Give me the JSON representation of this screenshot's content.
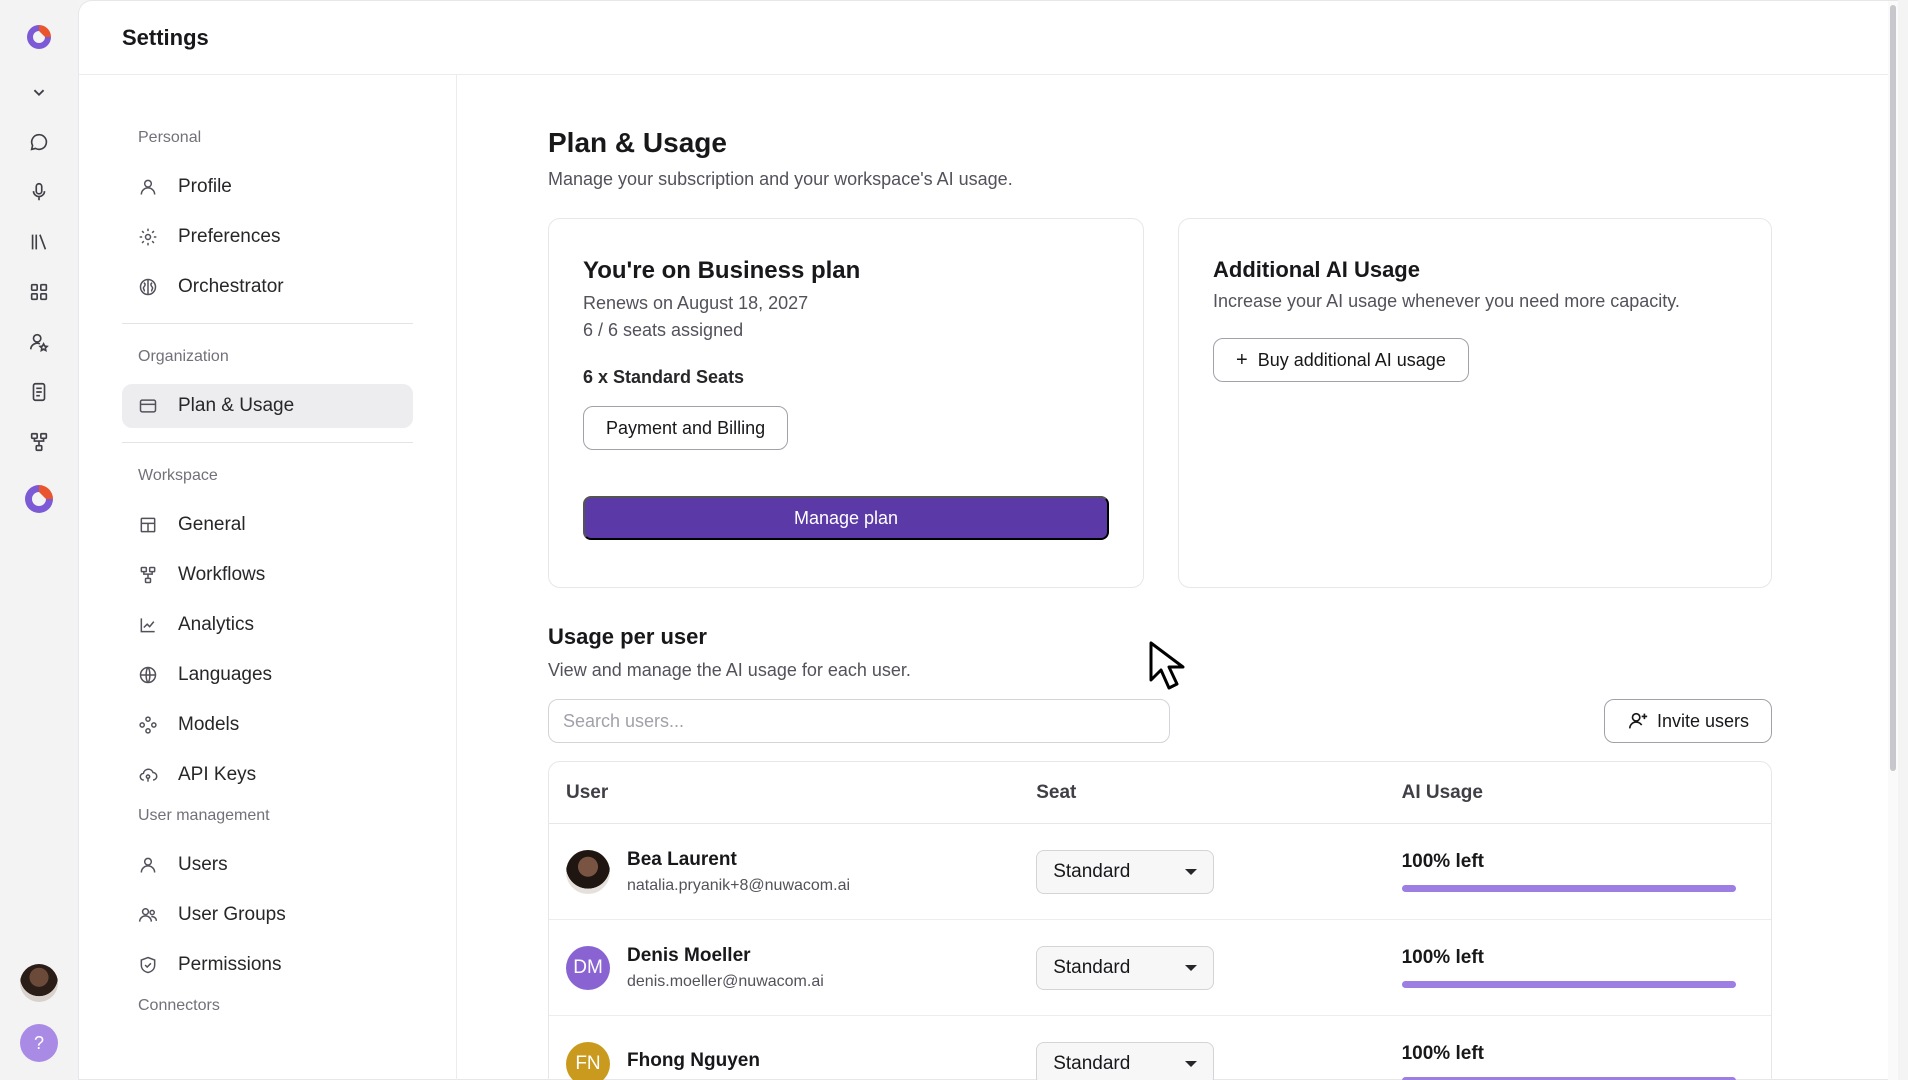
{
  "header": {
    "title": "Settings"
  },
  "nav": {
    "sections": [
      {
        "label": "Personal",
        "items": [
          "Profile",
          "Preferences",
          "Orchestrator"
        ]
      },
      {
        "label": "Organization",
        "items": [
          "Plan & Usage"
        ]
      },
      {
        "label": "Workspace",
        "items": [
          "General",
          "Workflows",
          "Analytics",
          "Languages",
          "Models",
          "API Keys"
        ]
      },
      {
        "label": "User management",
        "items": [
          "Users",
          "User Groups",
          "Permissions"
        ]
      },
      {
        "label": "Connectors",
        "items": []
      }
    ],
    "active": "Plan & Usage"
  },
  "page": {
    "title": "Plan & Usage",
    "subtitle": "Manage your subscription and your workspace's AI usage."
  },
  "plan_card": {
    "title": "You're on Business plan",
    "renews": "Renews on August 18, 2027",
    "seats_assigned": "6 / 6 seats assigned",
    "seat_summary": "6 x Standard Seats",
    "billing_button": "Payment and Billing",
    "manage_button": "Manage plan"
  },
  "addon_card": {
    "title": "Additional AI Usage",
    "text": "Increase your AI usage whenever you need more capacity.",
    "button": "Buy additional AI usage"
  },
  "usage": {
    "title": "Usage per user",
    "subtitle": "View and manage the AI usage for each user.",
    "search_placeholder": "Search users...",
    "invite_button": "Invite users",
    "columns": [
      "User",
      "Seat",
      "AI Usage"
    ],
    "rows": [
      {
        "name": "Bea Laurent",
        "email": "natalia.pryanik+8@nuwacom.ai",
        "initials": "",
        "avatar_color": "#2a1d18",
        "seat": "Standard",
        "usage_label": "100% left",
        "usage_fraction": 1.0
      },
      {
        "name": "Denis Moeller",
        "email": "denis.moeller@nuwacom.ai",
        "initials": "DM",
        "avatar_color": "#8a63d2",
        "seat": "Standard",
        "usage_label": "100% left",
        "usage_fraction": 1.0
      },
      {
        "name": "Fhong Nguyen",
        "email": "",
        "initials": "FN",
        "avatar_color": "#c99a1e",
        "seat": "Standard",
        "usage_label": "100% left",
        "usage_fraction": 1.0
      }
    ]
  },
  "help": {
    "label": "?"
  },
  "colors": {
    "accent": "#5b3aa8",
    "usage_bar": "#9d7ee3"
  }
}
